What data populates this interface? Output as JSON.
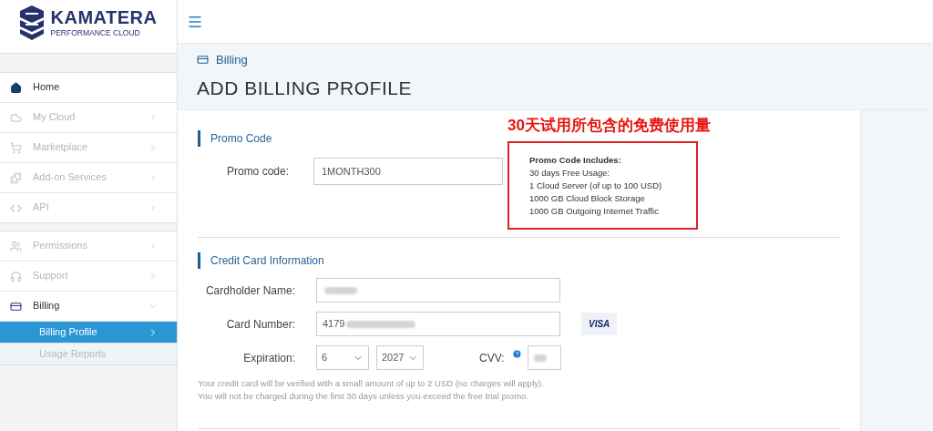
{
  "logo": {
    "name": "KAMATERA",
    "tagline": "PERFORMANCE CLOUD"
  },
  "sidebar": {
    "groups": [
      {
        "items": [
          {
            "label": "Home",
            "disabled": false
          },
          {
            "label": "My Cloud",
            "disabled": true,
            "expanded": false
          },
          {
            "label": "Marketplace",
            "disabled": true,
            "expanded": false
          },
          {
            "label": "Add-on Services",
            "disabled": true,
            "expanded": false
          },
          {
            "label": "API",
            "disabled": true,
            "expanded": false
          }
        ]
      },
      {
        "items": [
          {
            "label": "Permissions",
            "disabled": true,
            "expanded": false
          },
          {
            "label": "Support",
            "disabled": true,
            "expanded": false
          },
          {
            "label": "Billing",
            "disabled": false,
            "expanded": true,
            "children": [
              {
                "label": "Billing Profile",
                "selected": true
              },
              {
                "label": "Usage Reports",
                "selected": false
              }
            ]
          }
        ]
      }
    ]
  },
  "breadcrumb": "Billing",
  "page_title": "ADD BILLING PROFILE",
  "annotation": {
    "text": "30天试用所包含的免费使用量",
    "lines": [
      "Promo Code Includes:",
      "30 days Free Usage:",
      "1 Cloud Server (of up to 100 USD)",
      "1000 GB Cloud Block Storage",
      "1000 GB Outgoing Internet Traffic"
    ]
  },
  "promo_section": {
    "title": "Promo Code",
    "label": "Promo code:",
    "value": "1MONTH300"
  },
  "card_section": {
    "title": "Credit Card Information",
    "cardholder_label": "Cardholder Name:",
    "card_number_label": "Card Number:",
    "card_number_value": "4179",
    "card_brand": "VISA",
    "expiration_label": "Expiration:",
    "month": "6",
    "year": "2027",
    "cvv_label": "CVV:",
    "note": [
      "Your credit card will be verified with a small amount of up to 2 USD (no charges will apply).",
      "You will not be charged during the first 30 days unless you exceed the free trial promo."
    ]
  }
}
